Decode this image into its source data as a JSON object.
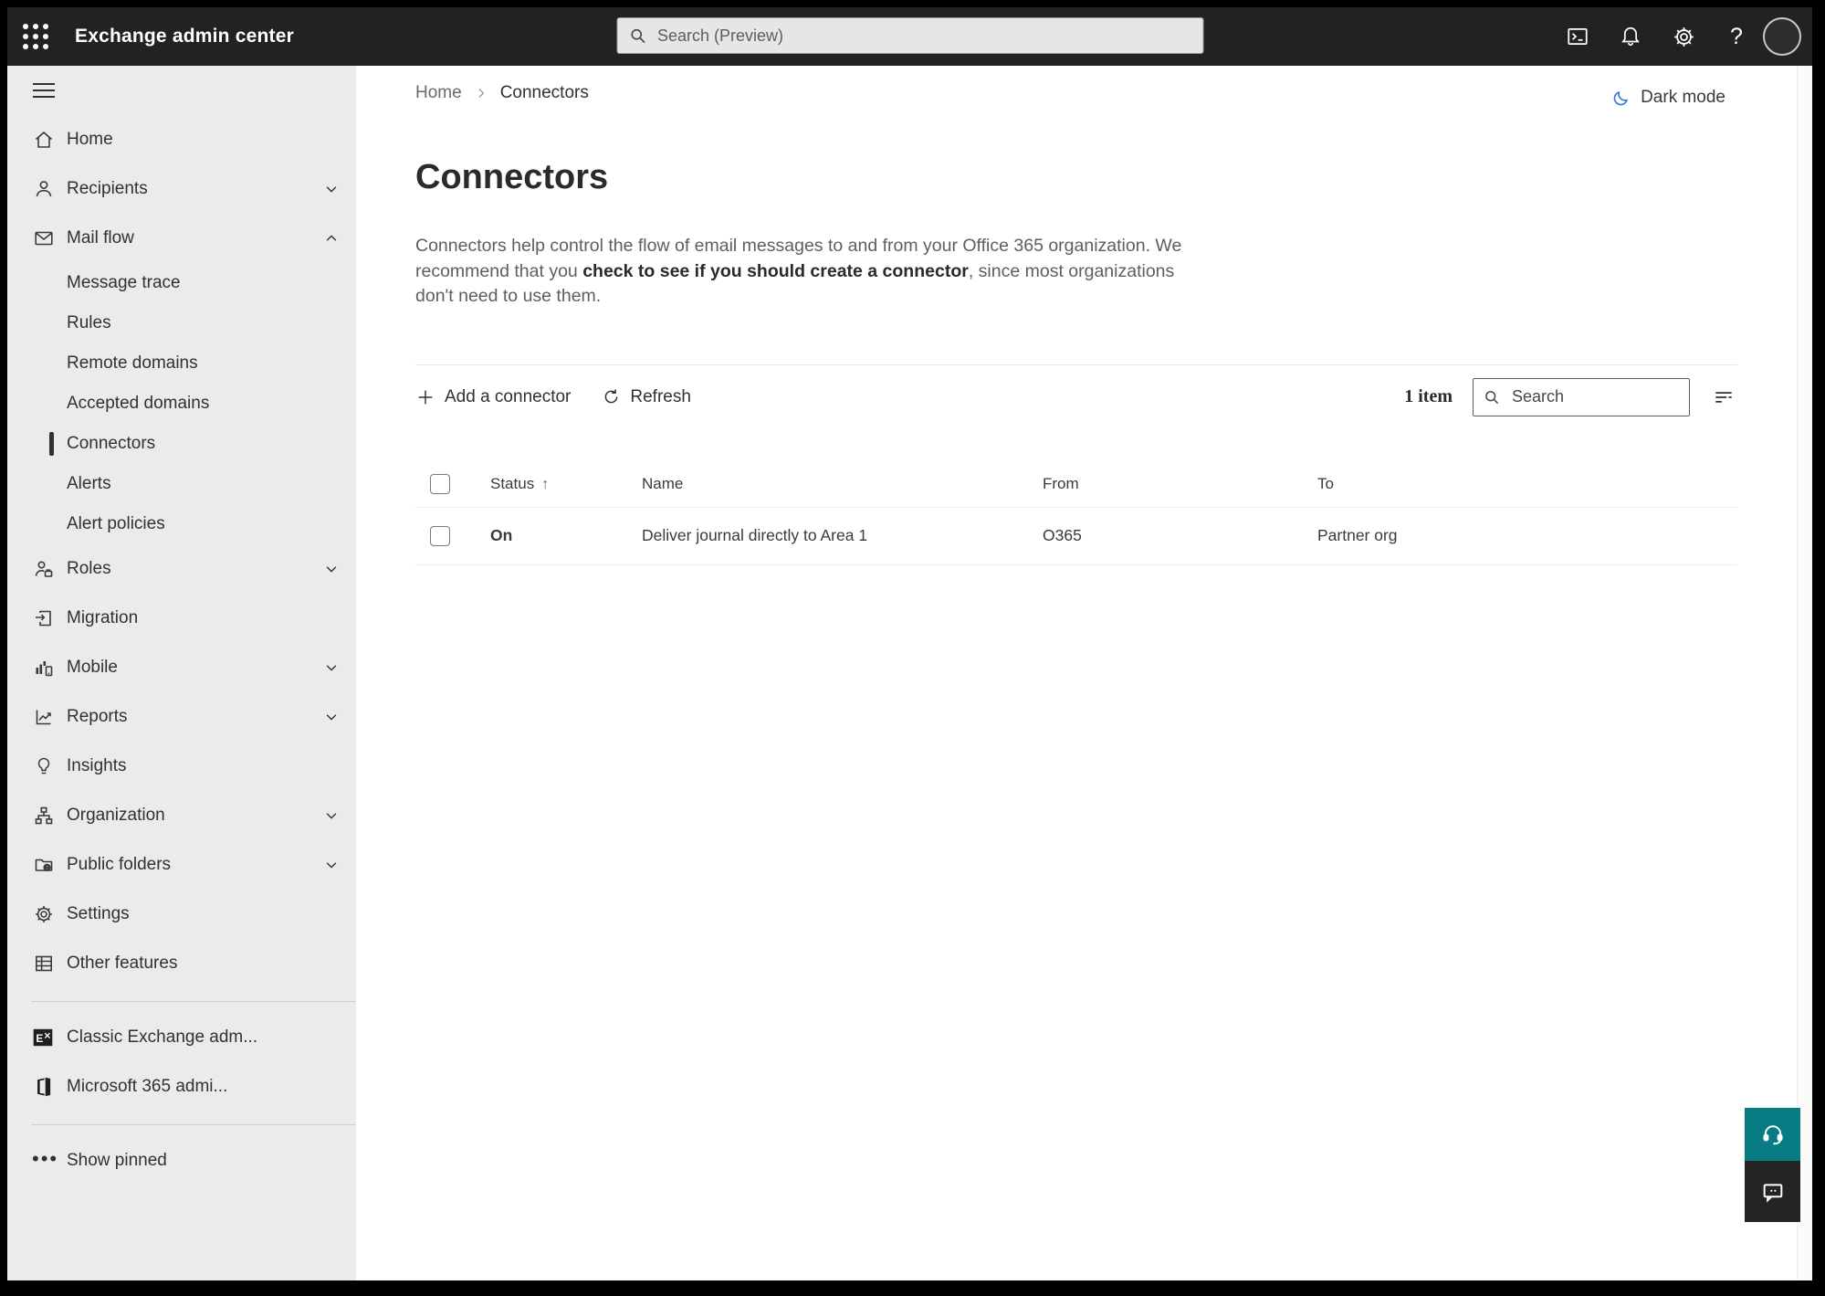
{
  "header": {
    "app_title": "Exchange admin center",
    "search_placeholder": "Search (Preview)",
    "help_glyph": "?"
  },
  "sidebar": {
    "items": [
      {
        "label": "Home"
      },
      {
        "label": "Recipients"
      },
      {
        "label": "Mail flow"
      },
      {
        "label": "Message trace"
      },
      {
        "label": "Rules"
      },
      {
        "label": "Remote domains"
      },
      {
        "label": "Accepted domains"
      },
      {
        "label": "Connectors"
      },
      {
        "label": "Alerts"
      },
      {
        "label": "Alert policies"
      },
      {
        "label": "Roles"
      },
      {
        "label": "Migration"
      },
      {
        "label": "Mobile"
      },
      {
        "label": "Reports"
      },
      {
        "label": "Insights"
      },
      {
        "label": "Organization"
      },
      {
        "label": "Public folders"
      },
      {
        "label": "Settings"
      },
      {
        "label": "Other features"
      },
      {
        "label": "Classic Exchange adm..."
      },
      {
        "label": "Microsoft 365 admi..."
      },
      {
        "label": "Show pinned"
      }
    ]
  },
  "breadcrumb": {
    "home": "Home",
    "current": "Connectors"
  },
  "dark_mode": {
    "label": "Dark mode"
  },
  "page": {
    "title": "Connectors",
    "description_part1": "Connectors help control the flow of email messages to and from your Office 365 organization. We recommend that you ",
    "description_link": "check to see if you should create a connector",
    "description_part2": ", since most organizations don't need to use them."
  },
  "toolbar": {
    "add_label": "Add a connector",
    "refresh_label": "Refresh",
    "item_count": "1 item",
    "search_placeholder": "Search"
  },
  "table": {
    "columns": {
      "status": "Status",
      "name": "Name",
      "from": "From",
      "to": "To"
    },
    "sort_arrow": "↑",
    "rows": [
      {
        "status": "On",
        "name": "Deliver journal directly to Area 1",
        "from": "O365",
        "to": "Partner org"
      }
    ]
  },
  "colors": {
    "topbar": "#232221",
    "sidebar": "#ebebeb",
    "accent_teal": "#077d83",
    "moon_blue": "#3579d8",
    "text_primary": "#323130",
    "text_secondary": "#605e5c"
  }
}
